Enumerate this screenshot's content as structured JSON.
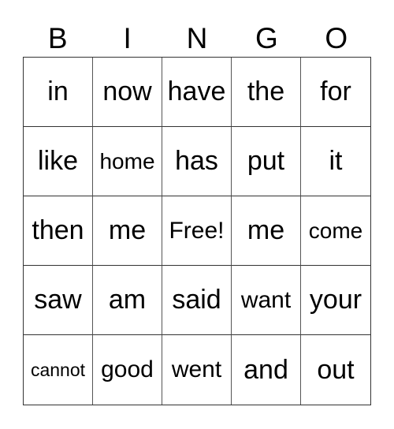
{
  "header": {
    "letters": [
      "B",
      "I",
      "N",
      "G",
      "O"
    ]
  },
  "grid": {
    "rows": [
      [
        "in",
        "now",
        "have",
        "the",
        "for"
      ],
      [
        "like",
        "home",
        "has",
        "put",
        "it"
      ],
      [
        "then",
        "me",
        "Free!",
        "me",
        "come"
      ],
      [
        "saw",
        "am",
        "said",
        "want",
        "your"
      ],
      [
        "cannot",
        "good",
        "went",
        "and",
        "out"
      ]
    ],
    "free_space": "Free!"
  }
}
